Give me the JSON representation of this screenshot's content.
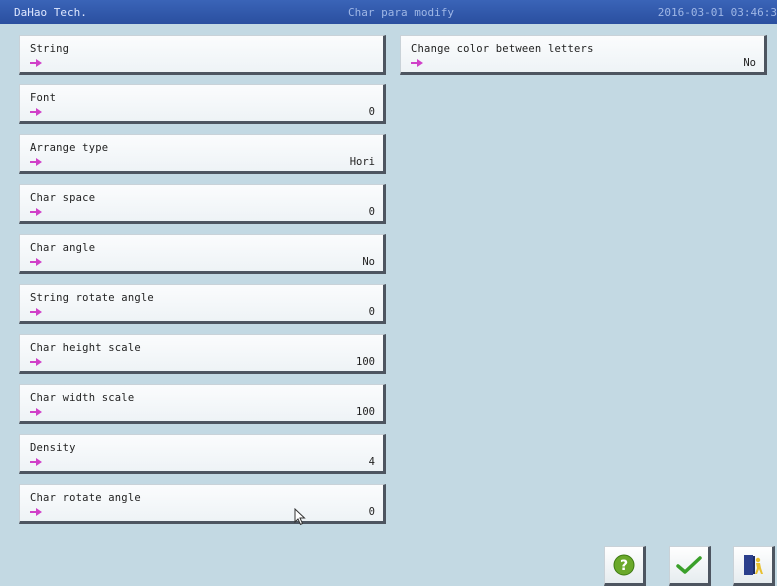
{
  "titlebar": {
    "left": "DaHao Tech.",
    "center": "Char para modify",
    "right": "2016-03-01 03:46:3"
  },
  "params": [
    {
      "label": "String",
      "value": ""
    },
    {
      "label": "Font",
      "value": "0"
    },
    {
      "label": "Arrange type",
      "value": "Hori"
    },
    {
      "label": "Char space",
      "value": "0"
    },
    {
      "label": "Char angle",
      "value": "No"
    },
    {
      "label": "String rotate angle",
      "value": "0"
    },
    {
      "label": "Char height scale",
      "value": "100"
    },
    {
      "label": "Char width scale",
      "value": "100"
    },
    {
      "label": "Density",
      "value": "4"
    },
    {
      "label": "Char rotate angle",
      "value": "0"
    },
    {
      "label": "Change color between letters",
      "value": "No"
    }
  ],
  "buttons": {
    "help": "help-icon",
    "confirm": "checkmark-icon",
    "exit": "exit-door-icon"
  },
  "colors": {
    "titlebar": "#2a4fa0",
    "background": "#c3d9e3",
    "arrow": "#d040c8",
    "help": "#6aa92a",
    "check": "#3aa02a",
    "door": "#2b3f8c",
    "person": "#e8c030"
  }
}
